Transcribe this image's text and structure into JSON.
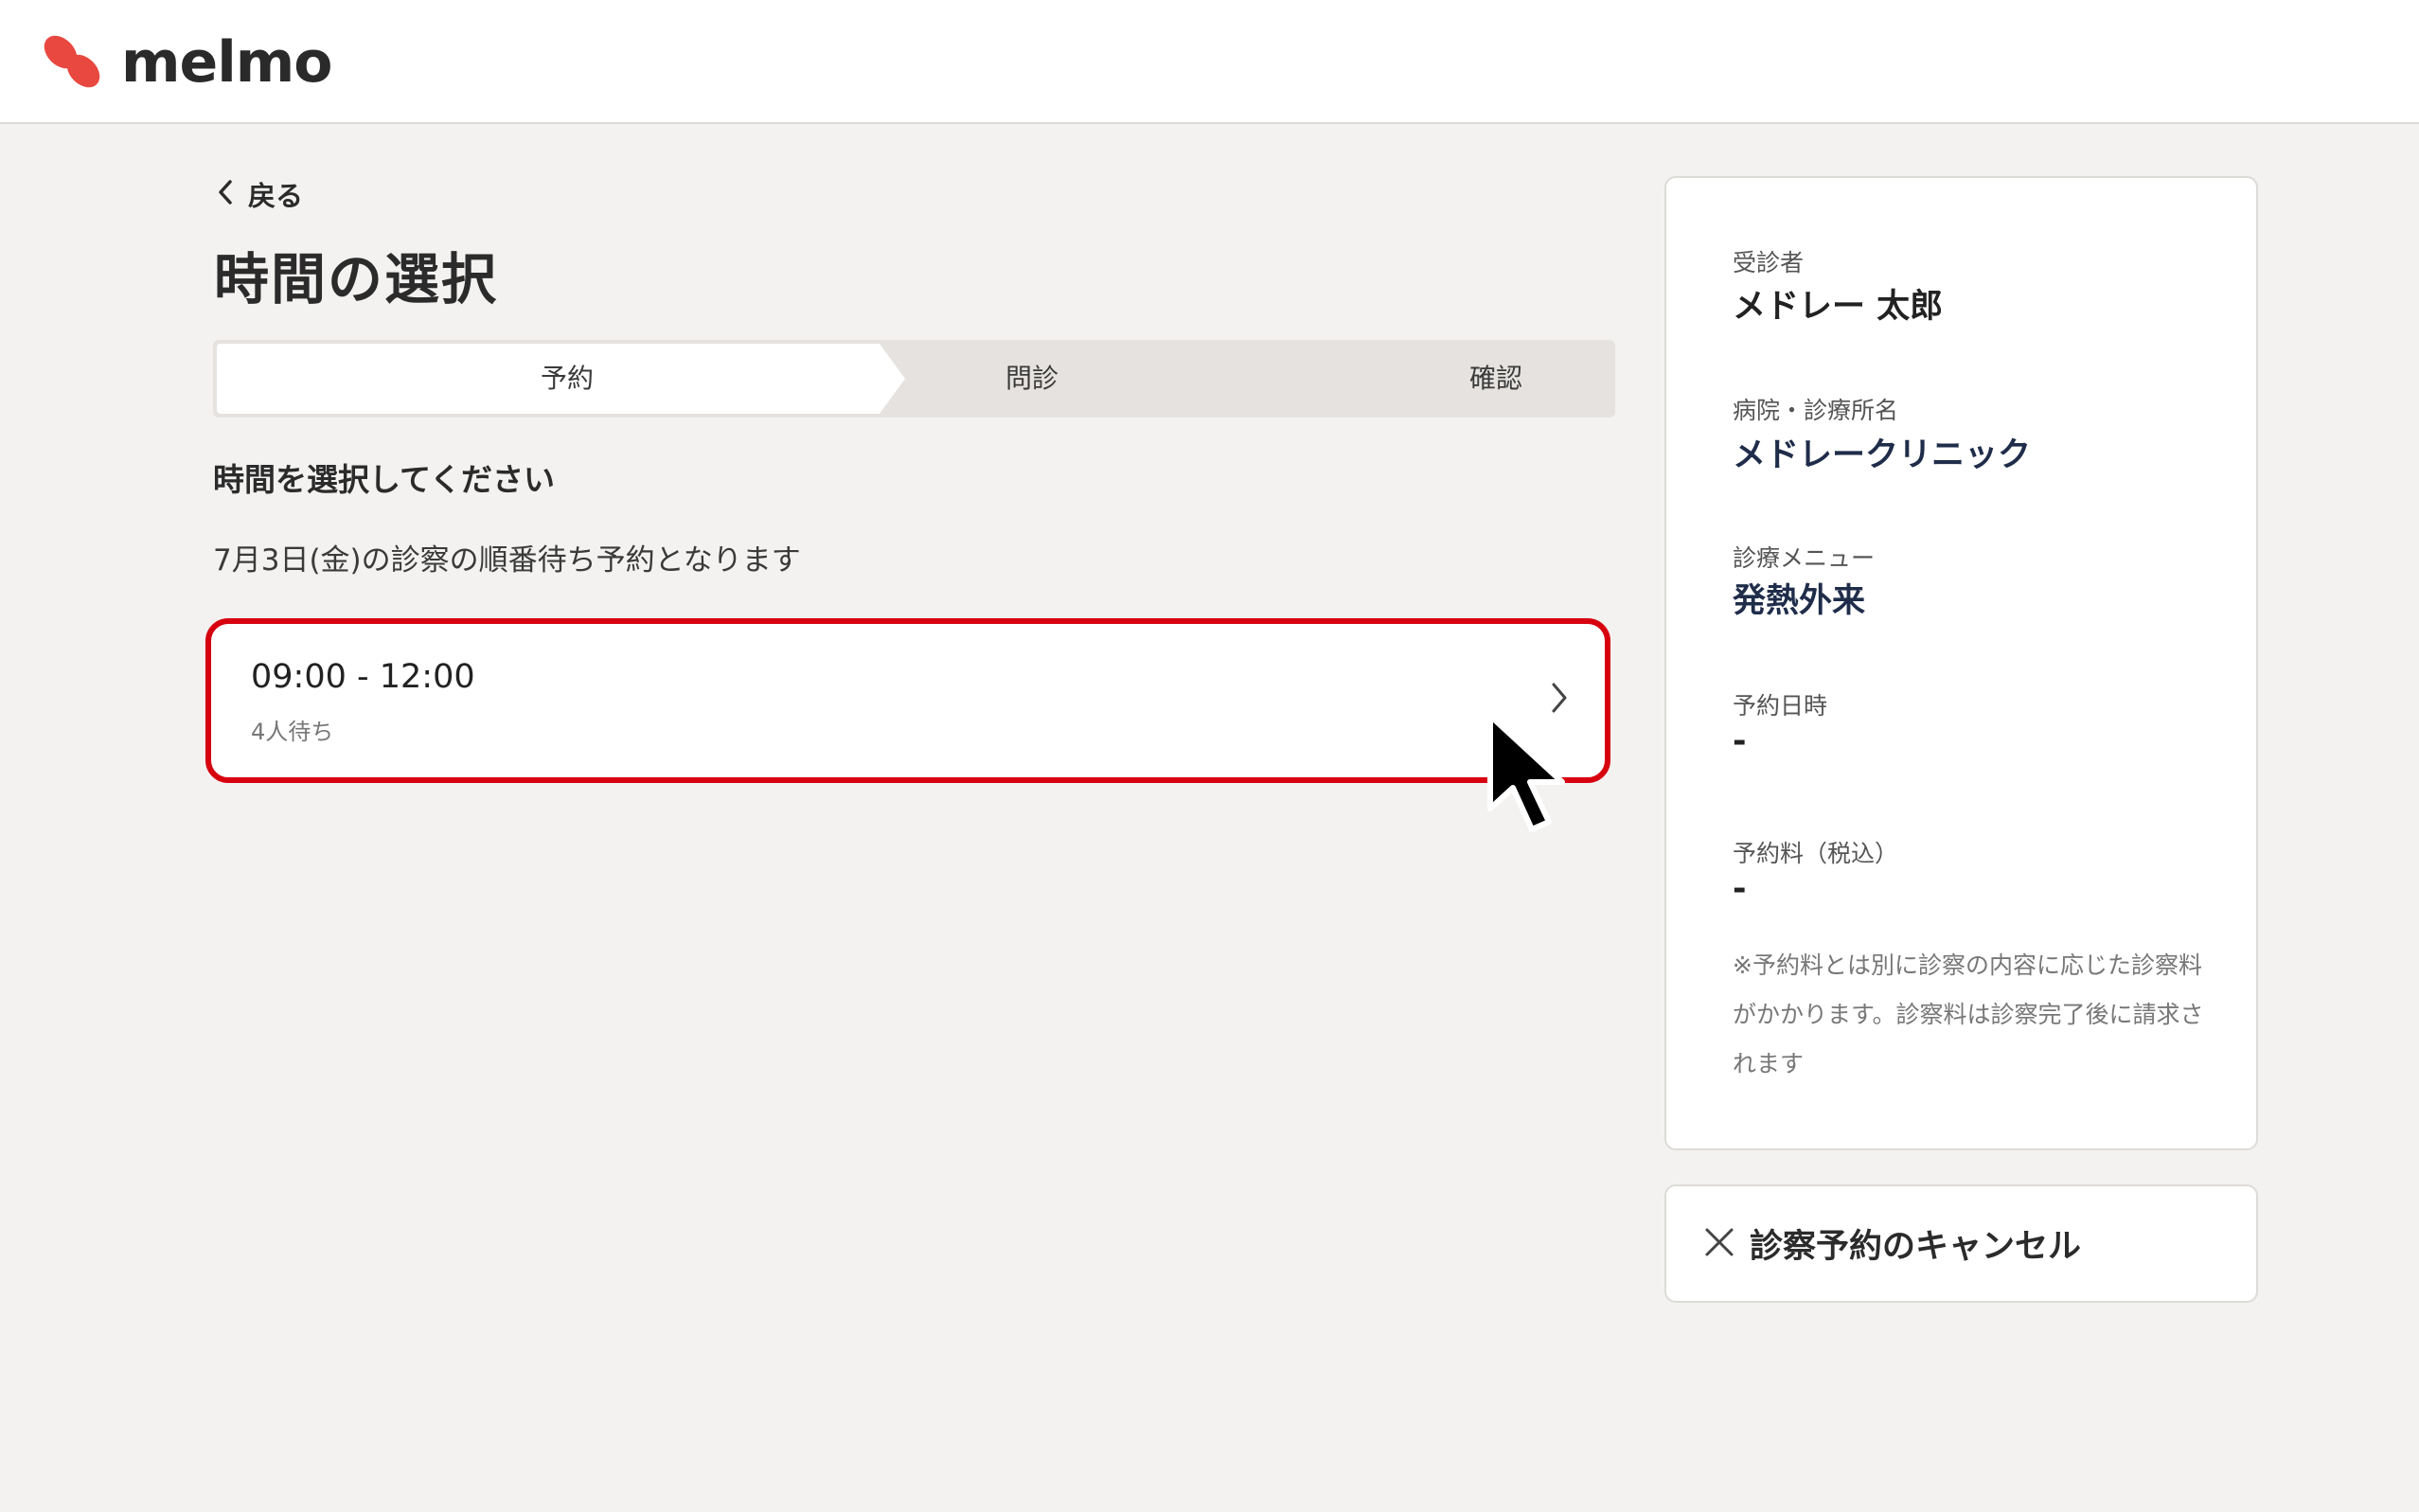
{
  "header": {
    "logo_text": "melmo",
    "logo_icon": "melmo-logo-icon"
  },
  "nav": {
    "back_label": "戻る",
    "back_icon": "chevron-left-icon"
  },
  "page": {
    "title": "時間の選択"
  },
  "stepper": {
    "steps": [
      {
        "label": "予約",
        "active": true
      },
      {
        "label": "問診",
        "active": false
      },
      {
        "label": "確認",
        "active": false
      }
    ]
  },
  "main": {
    "section_heading": "時間を選択してください",
    "info": "7月3日(金)の診察の順番待ち予約となります",
    "slots": [
      {
        "time": "09:00 - 12:00",
        "wait": "4人待ち",
        "icon": "chevron-right-icon"
      }
    ]
  },
  "summary": {
    "patient_label": "受診者",
    "patient_value": "メドレー 太郎",
    "clinic_label": "病院・診療所名",
    "clinic_value": "メドレークリニック",
    "menu_label": "診療メニュー",
    "menu_value": "発熱外来",
    "datetime_label": "予約日時",
    "datetime_value": "-",
    "fee_label": "予約料（税込）",
    "fee_value": "-",
    "note": "※予約料とは別に診察の内容に応じた診察料がかかります。診察料は診察完了後に請求されます"
  },
  "cancel": {
    "label": "診察予約のキャンセル",
    "icon": "close-icon"
  },
  "colors": {
    "brand": "#e8483f",
    "highlight": "#d7000f",
    "background": "#f3f2f0",
    "value_text": "#1f2d4a"
  }
}
